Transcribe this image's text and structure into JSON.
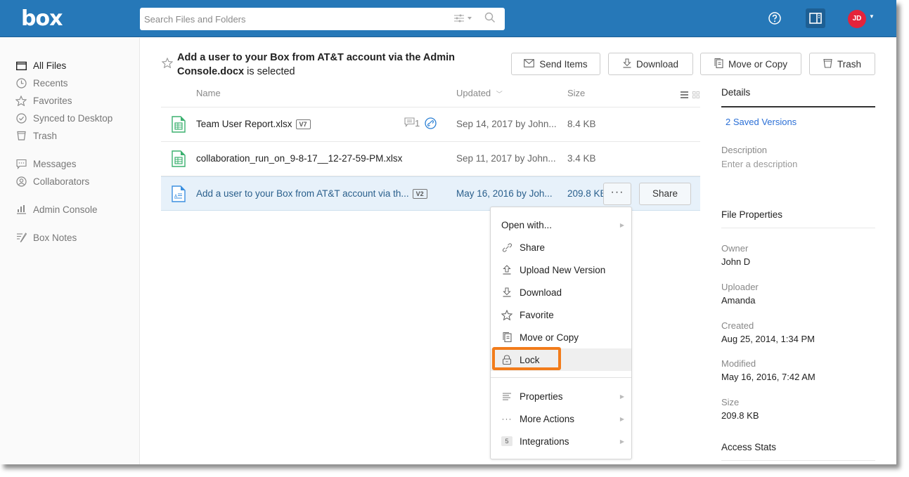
{
  "header": {
    "logo": "box",
    "search_placeholder": "Search Files and Folders",
    "avatar_initials": "JD",
    "brand_color": "#2678b8",
    "avatar_color": "#e5233b"
  },
  "sidebar": {
    "items": [
      {
        "label": "All Files",
        "icon": "folder-icon",
        "active": true
      },
      {
        "label": "Recents",
        "icon": "clock-icon"
      },
      {
        "label": "Favorites",
        "icon": "star-icon"
      },
      {
        "label": "Synced to Desktop",
        "icon": "check-circle-icon"
      },
      {
        "label": "Trash",
        "icon": "trash-icon"
      },
      {
        "label": "Messages",
        "icon": "message-icon"
      },
      {
        "label": "Collaborators",
        "icon": "user-circle-icon"
      },
      {
        "label": "Admin Console",
        "icon": "bar-chart-icon"
      },
      {
        "label": "Box Notes",
        "icon": "notes-icon"
      }
    ]
  },
  "selection": {
    "filename": "Add a user to your Box from AT&T account via the Admin Console.docx",
    "suffix": " is selected"
  },
  "toolbar": {
    "send_items": "Send Items",
    "download": "Download",
    "move_or_copy": "Move or Copy",
    "trash": "Trash"
  },
  "columns": {
    "name": "Name",
    "updated": "Updated",
    "size": "Size"
  },
  "files": [
    {
      "name": "Team User Report.xlsx",
      "version": "V7",
      "updated": "Sep 14, 2017 by John...",
      "size": "8.4 KB",
      "comments": "1",
      "type": "spreadsheet"
    },
    {
      "name": "collaboration_run_on_9-8-17__12-27-59-PM.xlsx",
      "version": "",
      "updated": "Sep 11, 2017 by John...",
      "size": "3.4 KB",
      "type": "spreadsheet"
    },
    {
      "name": "Add a user to your Box from AT&T account via th...",
      "version": "V2",
      "updated": "May 16, 2016 by Joh...",
      "size": "209.8 KB",
      "type": "document",
      "selected": true,
      "more_label": "···",
      "share_label": "Share"
    }
  ],
  "context_menu": {
    "items": [
      {
        "label": "Open with...",
        "submenu": true
      },
      {
        "label": "Share",
        "icon": "link-icon"
      },
      {
        "label": "Upload New Version",
        "icon": "upload-icon"
      },
      {
        "label": "Download",
        "icon": "download-icon"
      },
      {
        "label": "Favorite",
        "icon": "star-icon"
      },
      {
        "label": "Move or Copy",
        "icon": "copy-icon"
      },
      {
        "label": "Lock",
        "icon": "lock-icon",
        "highlighted": true
      },
      {
        "label": "Properties",
        "icon": "properties-icon",
        "submenu": true
      },
      {
        "label": "More Actions",
        "icon": "ellipsis-icon",
        "submenu": true
      },
      {
        "label": "Integrations",
        "icon": "integrations-badge",
        "badge": "5",
        "submenu": true
      }
    ],
    "highlight_color": "#f27c1b"
  },
  "details": {
    "tab": "Details",
    "versions": "2 Saved Versions",
    "description_label": "Description",
    "description_placeholder": "Enter a description",
    "file_properties": "File Properties",
    "owner_label": "Owner",
    "owner": "John D",
    "uploader_label": "Uploader",
    "uploader": "Amanda",
    "created_label": "Created",
    "created": "Aug 25, 2014, 1:34 PM",
    "modified_label": "Modified",
    "modified": "May 16, 2016, 7:42 AM",
    "size_label": "Size",
    "size": "209.8 KB",
    "access_stats": "Access Stats"
  }
}
